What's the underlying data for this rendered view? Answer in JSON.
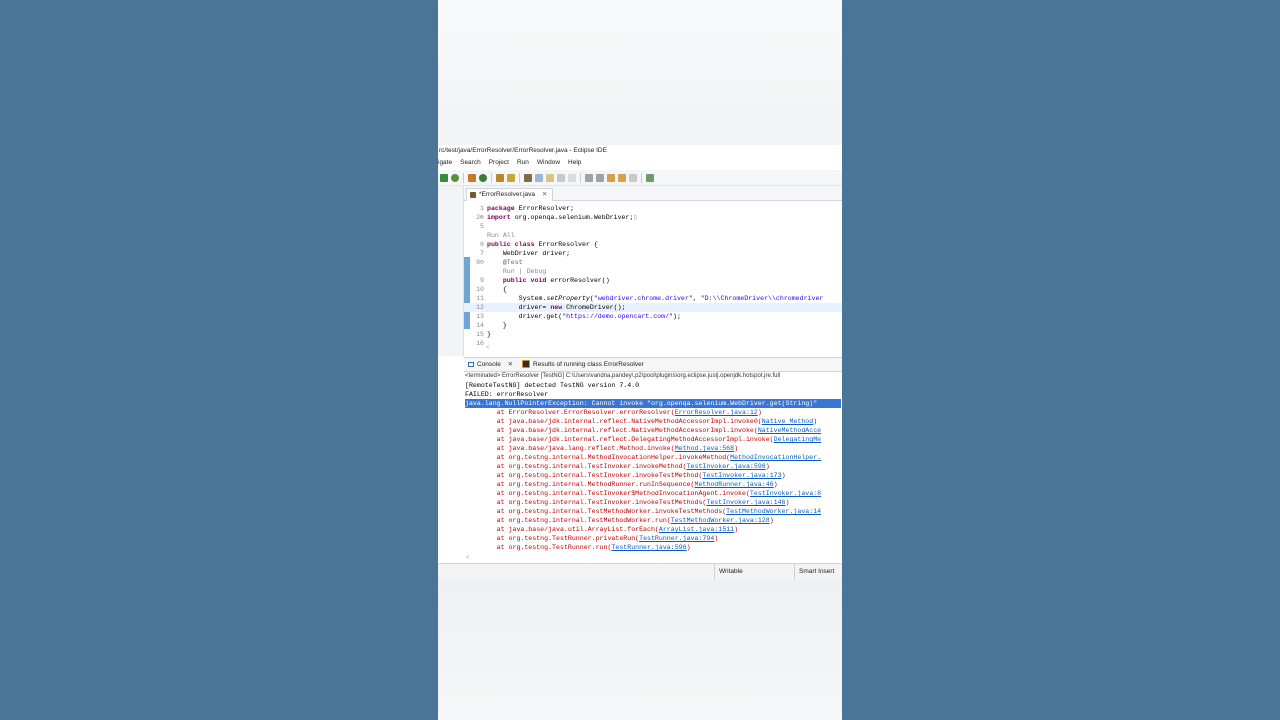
{
  "window": {
    "title": "rc/test/java/ErrorResolver/ErrorResolver.java - Eclipse IDE"
  },
  "menu": [
    "igate",
    "Search",
    "Project",
    "Run",
    "Window",
    "Help"
  ],
  "editor": {
    "tab_label": "*ErrorResolver.java",
    "tab_close": "✕",
    "lines": [
      {
        "n": "1",
        "parts": [
          [
            "kw",
            "package"
          ],
          [
            "",
            " ErrorResolver;"
          ]
        ]
      },
      {
        "n": "2⊕",
        "parts": [
          [
            "kw",
            "import"
          ],
          [
            "",
            " org.openqa.selenium.WebDriver;"
          ],
          [
            "lens",
            "▯"
          ]
        ]
      },
      {
        "n": "5",
        "parts": []
      },
      {
        "n": "",
        "parts": [
          [
            "lens",
            "Run All"
          ]
        ]
      },
      {
        "n": "6",
        "parts": [
          [
            "kw",
            "public class"
          ],
          [
            "",
            " ErrorResolver {"
          ]
        ]
      },
      {
        "n": "7",
        "parts": [
          [
            "",
            "    WebDriver "
          ],
          [
            "",
            "driver;"
          ]
        ]
      },
      {
        "n": "8⊖",
        "parts": [
          [
            "ann",
            "    @Test"
          ]
        ]
      },
      {
        "n": "",
        "parts": [
          [
            "lens",
            "    Run | Debug"
          ]
        ]
      },
      {
        "n": "9",
        "parts": [
          [
            "",
            "    "
          ],
          [
            "kw",
            "public void"
          ],
          [
            "",
            " errorResolver()"
          ]
        ]
      },
      {
        "n": "10",
        "parts": [
          [
            "",
            "    {"
          ]
        ]
      },
      {
        "n": "11",
        "parts": [
          [
            "",
            "        System."
          ],
          [
            "it",
            "setProperty"
          ],
          [
            "",
            "("
          ],
          [
            "str",
            "\"webdriver.chrome.driver\""
          ],
          [
            "",
            ", "
          ],
          [
            "str",
            "\"D:\\\\ChromeDriver\\\\chromedriver"
          ]
        ]
      },
      {
        "n": "12",
        "parts": [
          [
            "",
            "        driver= "
          ],
          [
            "kw",
            "new"
          ],
          [
            "",
            " ChromeDriver();"
          ]
        ],
        "highlight": true
      },
      {
        "n": "13",
        "parts": [
          [
            "",
            "        driver.get("
          ],
          [
            "str",
            "\"https://demo.opencart.com/\""
          ],
          [
            "",
            ");"
          ]
        ]
      },
      {
        "n": "14",
        "parts": [
          [
            "",
            "    }"
          ]
        ]
      },
      {
        "n": "15",
        "parts": [
          [
            "",
            "}"
          ]
        ]
      },
      {
        "n": "16",
        "parts": []
      }
    ],
    "hscroll_glyph": "<"
  },
  "console": {
    "tab_console": "Console",
    "tab_close": "✕",
    "tab_results": "Results of running class ErrorResolver",
    "terminated": "<terminated> ErrorResolver [TestNG] C:\\Users\\vandna.pandey\\.p2\\pool\\plugins\\org.eclipse.justj.openjdk.hotspot.jre.full",
    "lines": [
      {
        "text": "[RemoteTestNG] detected TestNG version 7.4.0",
        "cls": ""
      },
      {
        "text": "FAILED: errorResolver",
        "cls": ""
      },
      {
        "text": "java.lang.NullPointerException: Cannot invoke \"org.openqa.selenium.WebDriver.get(String)\"",
        "cls": "sel"
      }
    ],
    "stack": [
      {
        "at": "        at ErrorResolver.ErrorResolver.errorResolver(",
        "link": "ErrorResolver.java:12",
        "end": ")"
      },
      {
        "at": "        at java.base/jdk.internal.reflect.NativeMethodAccessorImpl.invoke0(",
        "link": "Native Method",
        "end": ")"
      },
      {
        "at": "        at java.base/jdk.internal.reflect.NativeMethodAccessorImpl.invoke(",
        "link": "NativeMethodAcce",
        "end": ""
      },
      {
        "at": "        at java.base/jdk.internal.reflect.DelegatingMethodAccessorImpl.invoke(",
        "link": "DelegatingMe",
        "end": ""
      },
      {
        "at": "        at java.base/java.lang.reflect.Method.invoke(",
        "link": "Method.java:568",
        "end": ")"
      },
      {
        "at": "        at org.testng.internal.MethodInvocationHelper.invokeMethod(",
        "link": "MethodInvocationHelper.",
        "end": ""
      },
      {
        "at": "        at org.testng.internal.TestInvoker.invokeMethod(",
        "link": "TestInvoker.java:598",
        "end": ")"
      },
      {
        "at": "        at org.testng.internal.TestInvoker.invokeTestMethod(",
        "link": "TestInvoker.java:173",
        "end": ")"
      },
      {
        "at": "        at org.testng.internal.MethodRunner.runInSequence(",
        "link": "MethodRunner.java:46",
        "end": ")"
      },
      {
        "at": "        at org.testng.internal.TestInvoker$MethodInvocationAgent.invoke(",
        "link": "TestInvoker.java:8",
        "end": ""
      },
      {
        "at": "        at org.testng.internal.TestInvoker.invokeTestMethods(",
        "link": "TestInvoker.java:146",
        "end": ")"
      },
      {
        "at": "        at org.testng.internal.TestMethodWorker.invokeTestMethods(",
        "link": "TestMethodWorker.java:14",
        "end": ""
      },
      {
        "at": "        at org.testng.internal.TestMethodWorker.run(",
        "link": "TestMethodWorker.java:128",
        "end": ")"
      },
      {
        "at": "        at java.base/java.util.ArrayList.forEach(",
        "link": "ArrayList.java:1511",
        "end": ")"
      },
      {
        "at": "        at org.testng.TestRunner.privateRun(",
        "link": "TestRunner.java:794",
        "end": ")"
      },
      {
        "at": "        at org.testng.TestRunner.run(",
        "link": "TestRunner.java:596",
        "end": ")"
      }
    ],
    "hscroll_glyph": "<"
  },
  "status": {
    "writable": "Writable",
    "insert_mode": "Smart Insert"
  },
  "colors": {
    "background": "#4a7597",
    "selection": "#3875d7",
    "keyword": "#7f0055",
    "string": "#2a00ff",
    "link": "#0b5bc6"
  }
}
